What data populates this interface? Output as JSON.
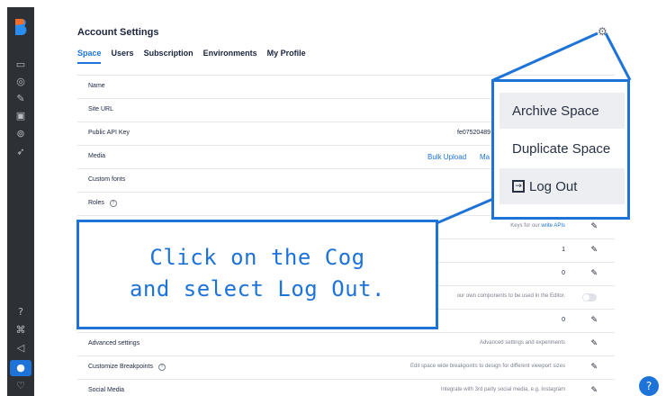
{
  "page": {
    "title": "Account Settings",
    "tabs": [
      "Space",
      "Users",
      "Subscription",
      "Environments",
      "My Profile"
    ],
    "active_tab": "Space"
  },
  "sidebar": {
    "icons": [
      "layers-icon",
      "database-icon",
      "magic-wand-icon",
      "calendar-icon",
      "workflow-icon",
      "rocket-icon",
      "help-icon",
      "command-icon",
      "megaphone-icon",
      "account-icon",
      "heart-icon"
    ]
  },
  "settings_rows": [
    {
      "label": "Name",
      "value": "",
      "desc": ""
    },
    {
      "label": "Site URL",
      "value": "",
      "desc": ""
    },
    {
      "label": "Public API Key",
      "value": "fe07520489",
      "desc": ""
    },
    {
      "label": "Media",
      "value": "",
      "desc": ""
    },
    {
      "label": "Custom fonts",
      "value": "",
      "desc": ""
    },
    {
      "label": "Roles",
      "value": "",
      "desc": ""
    },
    {
      "label": "",
      "value": "",
      "desc": "Keys for our write APIs"
    },
    {
      "label": "",
      "value": "1",
      "desc": ""
    },
    {
      "label": "",
      "value": "0",
      "desc": ""
    },
    {
      "label": "",
      "value": "",
      "desc": "our own components to be used in the Editor."
    },
    {
      "label": "",
      "value": "0",
      "desc": ""
    },
    {
      "label": "Advanced settings",
      "value": "",
      "desc": "Advanced settings and experiments"
    },
    {
      "label": "Customize Breakpoints",
      "value": "",
      "desc": "Edit space wide breakpoints to design for different viewport sizes"
    },
    {
      "label": "Social Media",
      "value": "",
      "desc": "Integrate with 3rd party social media, e.g. Instagram"
    }
  ],
  "media_links": {
    "bulk_upload": "Bulk Upload",
    "manage": "Ma"
  },
  "write_api_link": "write APIs",
  "dropdown_menu": {
    "items": [
      "Archive Space",
      "Duplicate Space",
      "Log Out"
    ]
  },
  "callout": {
    "line1": "Click on the Cog",
    "line2": "and select Log Out."
  },
  "colors": {
    "accent": "#1e73d8",
    "sidebar": "#2d3035",
    "text": "#1b243f"
  }
}
